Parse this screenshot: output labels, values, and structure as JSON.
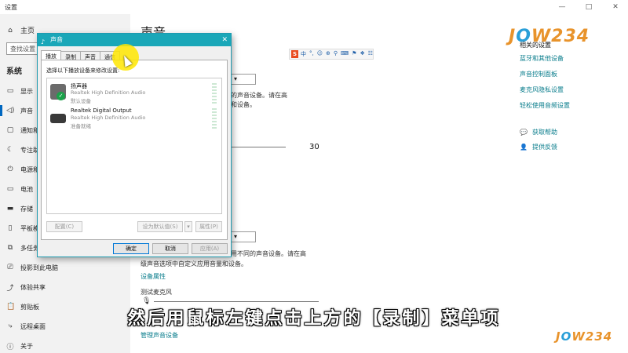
{
  "settings": {
    "title": "设置",
    "home": "主页",
    "search_placeholder": "查找设置",
    "section": "系统",
    "nav": [
      {
        "label": "显示",
        "icon": "display-icon"
      },
      {
        "label": "声音",
        "icon": "speaker-icon"
      },
      {
        "label": "通知和",
        "icon": "notification-icon"
      },
      {
        "label": "专注助",
        "icon": "moon-icon"
      },
      {
        "label": "电源和",
        "icon": "power-icon"
      },
      {
        "label": "电池",
        "icon": "battery-icon"
      },
      {
        "label": "存储",
        "icon": "storage-icon"
      },
      {
        "label": "平板模",
        "icon": "tablet-icon"
      },
      {
        "label": "多任务",
        "icon": "multitask-icon"
      },
      {
        "label": "投影到此电脑",
        "icon": "project-icon"
      },
      {
        "label": "体验共享",
        "icon": "share-icon"
      },
      {
        "label": "剪贴板",
        "icon": "clipboard-icon"
      },
      {
        "label": "远程桌面",
        "icon": "remote-icon"
      },
      {
        "label": "关于",
        "icon": "info-icon"
      }
    ],
    "active_index": 1
  },
  "content": {
    "page_title": "声音",
    "output_text_1": "的声音设备。请在高",
    "output_text_2": "和设备。",
    "volume": "30",
    "input_text_1": "用不同的声音设备。请在高",
    "input_text_2": "级声音选项中自定义应用音量和设备。",
    "device_props": "设备属性",
    "test_mic": "测试麦克风",
    "manage_devices": "管理声音设备"
  },
  "related": {
    "title": "相关的设置",
    "links": [
      "蓝牙和其他设备",
      "声音控制面板",
      "麦克风隐私设置",
      "轻松使用音频设置"
    ],
    "help": "获取帮助",
    "feedback": "提供反馈"
  },
  "ime": {
    "logo": "S",
    "items": [
      "中",
      "°,",
      "☺",
      "⊕",
      "⚲",
      "⌨",
      "⚑",
      "❖",
      "☷"
    ]
  },
  "logo": {
    "prefix": "J",
    "o": "O",
    "rest": "W234"
  },
  "subtitle": "然后用鼠标左键点击上方的【录制】菜单项",
  "dialog": {
    "title": "声音",
    "tabs": [
      "播放",
      "录制",
      "声音",
      "通信"
    ],
    "hint": "选择以下播放设备来修改设置:",
    "devices": [
      {
        "name": "扬声器",
        "driver": "Realtek High Definition Audio",
        "state": "默认设备"
      },
      {
        "name": "Realtek Digital Output",
        "driver": "Realtek High Definition Audio",
        "state": "准备就绪"
      }
    ],
    "configure": "配置(C)",
    "set_default": "设为默认值(S)",
    "properties": "属性(P)",
    "ok": "确定",
    "cancel": "取消",
    "apply": "应用(A)"
  },
  "colors": {
    "accent": "#1aa7b8",
    "link": "#0a7d8c",
    "cursor_highlight": "#ffe600"
  }
}
